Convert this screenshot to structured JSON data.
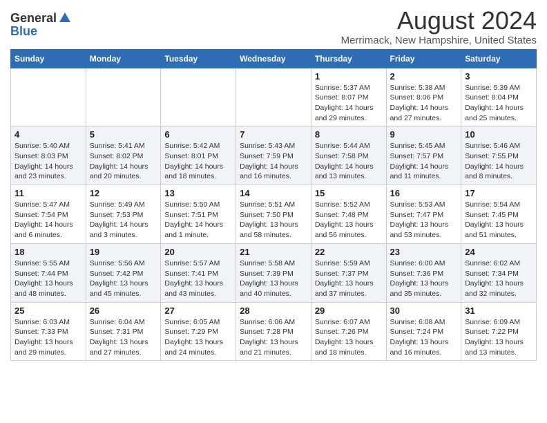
{
  "logo": {
    "general": "General",
    "blue": "Blue"
  },
  "title": "August 2024",
  "subtitle": "Merrimack, New Hampshire, United States",
  "days_of_week": [
    "Sunday",
    "Monday",
    "Tuesday",
    "Wednesday",
    "Thursday",
    "Friday",
    "Saturday"
  ],
  "weeks": [
    [
      {
        "day": "",
        "info": ""
      },
      {
        "day": "",
        "info": ""
      },
      {
        "day": "",
        "info": ""
      },
      {
        "day": "",
        "info": ""
      },
      {
        "day": "1",
        "info": "Sunrise: 5:37 AM\nSunset: 8:07 PM\nDaylight: 14 hours and 29 minutes."
      },
      {
        "day": "2",
        "info": "Sunrise: 5:38 AM\nSunset: 8:06 PM\nDaylight: 14 hours and 27 minutes."
      },
      {
        "day": "3",
        "info": "Sunrise: 5:39 AM\nSunset: 8:04 PM\nDaylight: 14 hours and 25 minutes."
      }
    ],
    [
      {
        "day": "4",
        "info": "Sunrise: 5:40 AM\nSunset: 8:03 PM\nDaylight: 14 hours and 23 minutes."
      },
      {
        "day": "5",
        "info": "Sunrise: 5:41 AM\nSunset: 8:02 PM\nDaylight: 14 hours and 20 minutes."
      },
      {
        "day": "6",
        "info": "Sunrise: 5:42 AM\nSunset: 8:01 PM\nDaylight: 14 hours and 18 minutes."
      },
      {
        "day": "7",
        "info": "Sunrise: 5:43 AM\nSunset: 7:59 PM\nDaylight: 14 hours and 16 minutes."
      },
      {
        "day": "8",
        "info": "Sunrise: 5:44 AM\nSunset: 7:58 PM\nDaylight: 14 hours and 13 minutes."
      },
      {
        "day": "9",
        "info": "Sunrise: 5:45 AM\nSunset: 7:57 PM\nDaylight: 14 hours and 11 minutes."
      },
      {
        "day": "10",
        "info": "Sunrise: 5:46 AM\nSunset: 7:55 PM\nDaylight: 14 hours and 8 minutes."
      }
    ],
    [
      {
        "day": "11",
        "info": "Sunrise: 5:47 AM\nSunset: 7:54 PM\nDaylight: 14 hours and 6 minutes."
      },
      {
        "day": "12",
        "info": "Sunrise: 5:49 AM\nSunset: 7:53 PM\nDaylight: 14 hours and 3 minutes."
      },
      {
        "day": "13",
        "info": "Sunrise: 5:50 AM\nSunset: 7:51 PM\nDaylight: 14 hours and 1 minute."
      },
      {
        "day": "14",
        "info": "Sunrise: 5:51 AM\nSunset: 7:50 PM\nDaylight: 13 hours and 58 minutes."
      },
      {
        "day": "15",
        "info": "Sunrise: 5:52 AM\nSunset: 7:48 PM\nDaylight: 13 hours and 56 minutes."
      },
      {
        "day": "16",
        "info": "Sunrise: 5:53 AM\nSunset: 7:47 PM\nDaylight: 13 hours and 53 minutes."
      },
      {
        "day": "17",
        "info": "Sunrise: 5:54 AM\nSunset: 7:45 PM\nDaylight: 13 hours and 51 minutes."
      }
    ],
    [
      {
        "day": "18",
        "info": "Sunrise: 5:55 AM\nSunset: 7:44 PM\nDaylight: 13 hours and 48 minutes."
      },
      {
        "day": "19",
        "info": "Sunrise: 5:56 AM\nSunset: 7:42 PM\nDaylight: 13 hours and 45 minutes."
      },
      {
        "day": "20",
        "info": "Sunrise: 5:57 AM\nSunset: 7:41 PM\nDaylight: 13 hours and 43 minutes."
      },
      {
        "day": "21",
        "info": "Sunrise: 5:58 AM\nSunset: 7:39 PM\nDaylight: 13 hours and 40 minutes."
      },
      {
        "day": "22",
        "info": "Sunrise: 5:59 AM\nSunset: 7:37 PM\nDaylight: 13 hours and 37 minutes."
      },
      {
        "day": "23",
        "info": "Sunrise: 6:00 AM\nSunset: 7:36 PM\nDaylight: 13 hours and 35 minutes."
      },
      {
        "day": "24",
        "info": "Sunrise: 6:02 AM\nSunset: 7:34 PM\nDaylight: 13 hours and 32 minutes."
      }
    ],
    [
      {
        "day": "25",
        "info": "Sunrise: 6:03 AM\nSunset: 7:33 PM\nDaylight: 13 hours and 29 minutes."
      },
      {
        "day": "26",
        "info": "Sunrise: 6:04 AM\nSunset: 7:31 PM\nDaylight: 13 hours and 27 minutes."
      },
      {
        "day": "27",
        "info": "Sunrise: 6:05 AM\nSunset: 7:29 PM\nDaylight: 13 hours and 24 minutes."
      },
      {
        "day": "28",
        "info": "Sunrise: 6:06 AM\nSunset: 7:28 PM\nDaylight: 13 hours and 21 minutes."
      },
      {
        "day": "29",
        "info": "Sunrise: 6:07 AM\nSunset: 7:26 PM\nDaylight: 13 hours and 18 minutes."
      },
      {
        "day": "30",
        "info": "Sunrise: 6:08 AM\nSunset: 7:24 PM\nDaylight: 13 hours and 16 minutes."
      },
      {
        "day": "31",
        "info": "Sunrise: 6:09 AM\nSunset: 7:22 PM\nDaylight: 13 hours and 13 minutes."
      }
    ]
  ]
}
